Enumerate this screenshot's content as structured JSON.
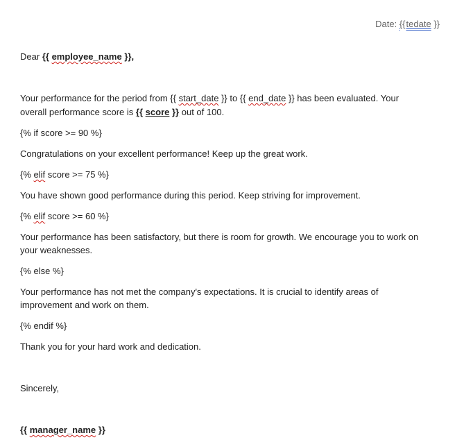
{
  "header": {
    "date_label": "Date:",
    "date_var_open": "{{",
    "date_var_name": "tedate",
    "date_var_close": "}}"
  },
  "salutation": {
    "dear": "Dear",
    "open": "{{",
    "var": "employee_name",
    "close": "}},"
  },
  "paragraph1": {
    "line1_a": "Your performance for the period from {{",
    "start_var": "start_date",
    "line1_b": "}} to {{",
    "end_var": "end_date",
    "line1_c": "}} has been evaluated. Your",
    "line2_a": "overall performance score is",
    "score_open": "{{",
    "score_var": "score",
    "score_close": "}}",
    "line2_b": "out of 100."
  },
  "blocks": [
    {
      "tag_pre": "{% if score >= 90 %}",
      "tag_kw": "",
      "tag_post": ""
    },
    {
      "text": "Congratulations on your excellent performance! Keep up the great work."
    },
    {
      "tag_pre": "{%",
      "tag_kw": "elif",
      "tag_post": "score >= 75 %}"
    },
    {
      "text": "You have shown good performance during this period. Keep striving for improvement."
    },
    {
      "tag_pre": "{%",
      "tag_kw": "elif",
      "tag_post": "score >= 60 %}"
    },
    {
      "text1": "Your performance has been satisfactory, but there is room for growth. We encourage you to work on",
      "text2": "your weaknesses."
    },
    {
      "tag_pre": "{% else %}"
    },
    {
      "text1": "Your performance has not met the company's expectations. It is crucial to identify areas of",
      "text2": "improvement and work on them."
    },
    {
      "tag_pre": "{% endif %}"
    },
    {
      "text": "Thank you for your hard work and dedication."
    }
  ],
  "closing": {
    "sincerely": "Sincerely,",
    "mgr_open": "{{",
    "mgr_var": "manager_name",
    "mgr_close": "}}"
  }
}
